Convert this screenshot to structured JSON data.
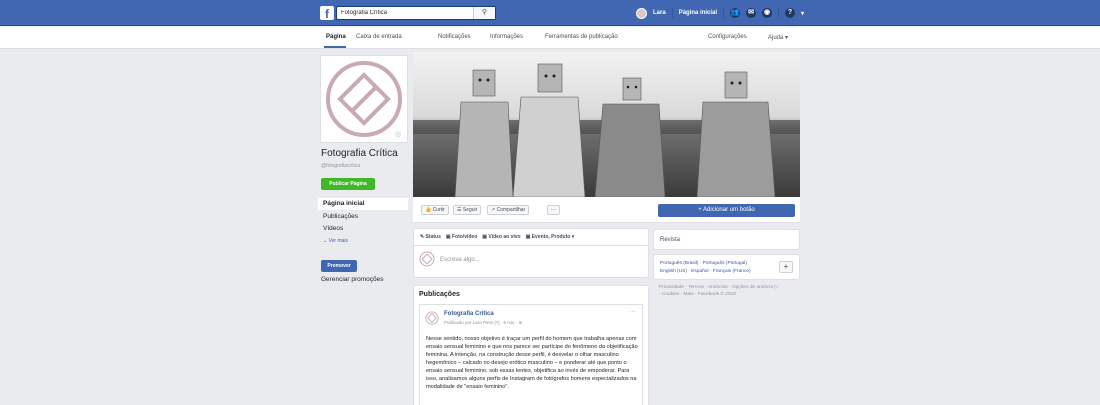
{
  "topbar": {
    "logo": "f",
    "search_value": "Fotografia Crítica",
    "user_name": "Lara",
    "home_label": "Página inicial",
    "colors": {
      "bar": "#4267b2"
    }
  },
  "pagenav": {
    "tabs": [
      "Página",
      "Caixa de entrada",
      "Notificações",
      "Informações",
      "Ferramentas de publicação"
    ],
    "right": [
      "Configurações",
      "Ajuda ▾"
    ]
  },
  "page": {
    "name": "Fotografia Crítica",
    "handle": "@fotografiacritica",
    "publish_label": "Publicar Página"
  },
  "leftnav": {
    "items": [
      "Página inicial",
      "Publicações",
      "Vídeos"
    ],
    "more": "⌄  Ver mais",
    "promote": "Promover",
    "manage": "Gerenciar promoções"
  },
  "actions": {
    "like": "👍 Curtir",
    "follow": "☰ Seguir",
    "share": "↗ Compartilhar",
    "more": "···",
    "add_button": "+ Adicionar um botão"
  },
  "composer": {
    "tabs": [
      "✎ Status",
      "▣ Foto/vídeo",
      "▣ Vídeo ao vivo",
      "▣ Evento, Produto ▾"
    ],
    "placeholder": "Escreva algo..."
  },
  "publications": {
    "title": "Publicações",
    "post": {
      "author": "Fotografia Crítica",
      "meta": "Publicado por Lara Pinto [?] · 9 min · ⊛",
      "dots": "···",
      "text": "Nesse sentido, nosso objetivo é traçar um perfil do homem que trabalha apenas com ensaio sensual feminino e que nos parece ser partícipe do fenômeno da objetificação feminina. A intenção, na construção desse perfil, é desvelar o olhar masculino hegemônico – calcado no desejo erótico masculino – e ponderar até que ponto o ensaio sensual feminino, sob essas lentes, objetifica ao invés de empoderar. Para isso, analisamos alguns perfis de Instagram de fotógrafos homens especializados na modalidade de \"ensaio feminino\"."
    }
  },
  "right": {
    "revista": "Revista",
    "languages_1": "Português (Brasil) · Português (Portugal)",
    "languages_2": "English (US) · Español · Français (France)",
    "plus": "+",
    "footer": "Privacidade · Termos · Anúncios · Opções de anúncio ▷ · Cookies · Mais · Facebook © 2018"
  }
}
